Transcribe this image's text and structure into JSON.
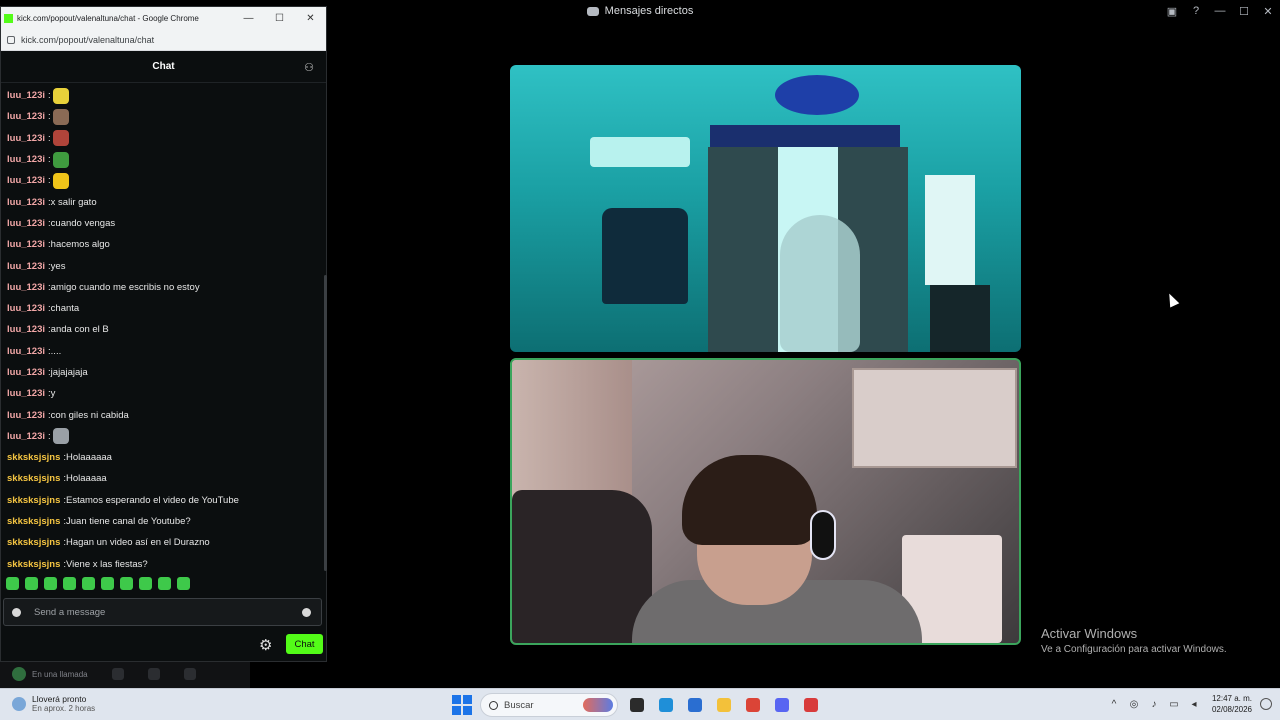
{
  "discord": {
    "window_title": "Mensajes directos",
    "titlebar_icons": [
      "inbox-icon",
      "help-icon"
    ],
    "window_controls": {
      "minimize": "—",
      "maximize": "☐",
      "close": "✕"
    },
    "watermark": {
      "title": "Activar Windows",
      "subtitle": "Ve a Configuración para activar Windows."
    },
    "callbar_text": "En una llamada"
  },
  "chrome": {
    "title": "kick.com/popout/valenaltuna/chat - Google Chrome",
    "url": "kick.com/popout/valenaltuna/chat",
    "controls": {
      "minimize": "—",
      "maximize": "☐",
      "close": "✕"
    }
  },
  "kick": {
    "header_title": "Chat",
    "accent": "#53fc18",
    "input_placeholder": "Send a message",
    "send_label": "Chat",
    "messages": [
      {
        "user": "luu_123i",
        "text": "",
        "emote": "#e8d13a",
        "color": "#f2a7a7"
      },
      {
        "user": "luu_123i",
        "text": "",
        "emote": "#8a6a55",
        "color": "#f2a7a7"
      },
      {
        "user": "luu_123i",
        "text": "",
        "emote": "#b0443a",
        "color": "#f2a7a7"
      },
      {
        "user": "luu_123i",
        "text": "",
        "emote": "#3f9b3f",
        "color": "#f2a7a7"
      },
      {
        "user": "luu_123i",
        "text": "",
        "emote": "#f0c419",
        "color": "#f2a7a7"
      },
      {
        "user": "luu_123i",
        "text": "x salir gato",
        "emote": "",
        "color": "#f2a7a7"
      },
      {
        "user": "luu_123i",
        "text": "cuando vengas",
        "emote": "",
        "color": "#f2a7a7"
      },
      {
        "user": "luu_123i",
        "text": "hacemos algo",
        "emote": "",
        "color": "#f2a7a7"
      },
      {
        "user": "luu_123i",
        "text": "yes",
        "emote": "",
        "color": "#f2a7a7"
      },
      {
        "user": "luu_123i",
        "text": "amigo cuando me escribis no estoy",
        "emote": "",
        "color": "#f2a7a7"
      },
      {
        "user": "luu_123i",
        "text": "chanta",
        "emote": "",
        "color": "#f2a7a7"
      },
      {
        "user": "luu_123i",
        "text": "anda con el B",
        "emote": "",
        "color": "#f2a7a7"
      },
      {
        "user": "luu_123i",
        "text": "....",
        "emote": "",
        "color": "#f2a7a7"
      },
      {
        "user": "luu_123i",
        "text": "jajajajaja",
        "emote": "",
        "color": "#f2a7a7"
      },
      {
        "user": "luu_123i",
        "text": "y",
        "emote": "",
        "color": "#f2a7a7"
      },
      {
        "user": "luu_123i",
        "text": "con giles ni cabida",
        "emote": "",
        "color": "#f2a7a7"
      },
      {
        "user": "luu_123i",
        "text": "",
        "emote": "#9aa0a6",
        "color": "#f2a7a7"
      },
      {
        "user": "skksksjsjns",
        "text": "Holaaaaaa",
        "emote": "",
        "color": "#f5c542"
      },
      {
        "user": "skksksjsjns",
        "text": "Holaaaaa",
        "emote": "",
        "color": "#f5c542"
      },
      {
        "user": "skksksjsjns",
        "text": "Estamos esperando el video de YouTube",
        "emote": "",
        "color": "#f5c542"
      },
      {
        "user": "skksksjsjns",
        "text": "Juan tiene canal de Youtube?",
        "emote": "",
        "color": "#f5c542"
      },
      {
        "user": "skksksjsjns",
        "text": "Hagan un video así en el Durazno",
        "emote": "",
        "color": "#f5c542"
      },
      {
        "user": "skksksjsjns",
        "text": "Viene x las fiestas?",
        "emote": "",
        "color": "#f5c542"
      }
    ],
    "emote_bar_count": 10
  },
  "taskbar": {
    "weather_title": "Lloverá pronto",
    "weather_sub": "En aprox. 2 horas",
    "search_placeholder": "Buscar",
    "apps": [
      {
        "name": "file-explorer-icon",
        "color": "#2b2b2b"
      },
      {
        "name": "edge-icon",
        "color": "#1f8fd8"
      },
      {
        "name": "store-icon",
        "color": "#2a6ed1"
      },
      {
        "name": "folder-icon",
        "color": "#f3c13a"
      },
      {
        "name": "chrome-icon",
        "color": "#db4437"
      },
      {
        "name": "discord-icon",
        "color": "#5865f2"
      },
      {
        "name": "app-icon",
        "color": "#d83b3b"
      }
    ],
    "clock_time": "12:47 a. m.",
    "clock_date": "02/08/2026"
  }
}
